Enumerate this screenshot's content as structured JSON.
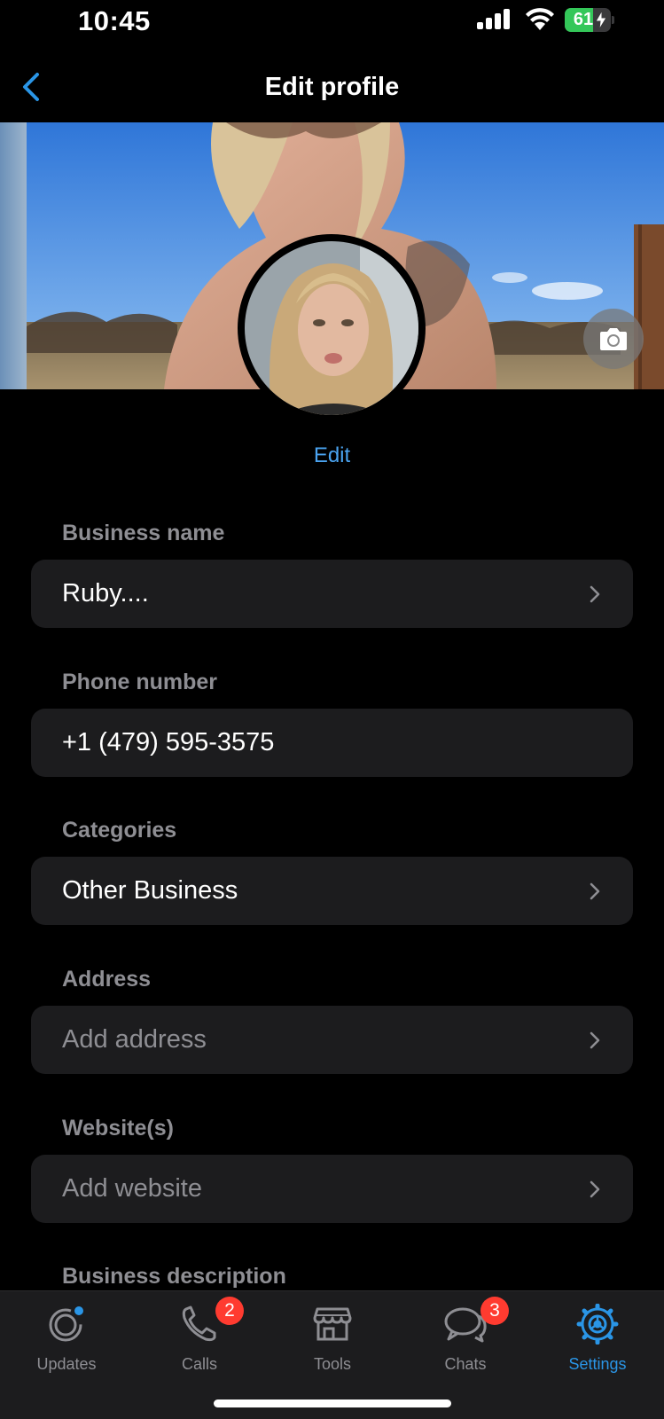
{
  "status_bar": {
    "time": "10:45",
    "battery": "61",
    "battery_level": 0.61
  },
  "nav": {
    "title": "Edit profile"
  },
  "profile": {
    "edit_label": "Edit"
  },
  "form": {
    "business_name": {
      "label": "Business name",
      "value": "Ruby...."
    },
    "phone_number": {
      "label": "Phone number",
      "value": "+1 (479) 595-3575"
    },
    "categories": {
      "label": "Categories",
      "value": "Other Business"
    },
    "address": {
      "label": "Address",
      "placeholder": "Add address"
    },
    "websites": {
      "label": "Website(s)",
      "placeholder": "Add website"
    },
    "business_description": {
      "label": "Business description"
    }
  },
  "tab_bar": {
    "tabs": [
      {
        "label": "Updates",
        "icon": "updates-icon",
        "active": false
      },
      {
        "label": "Calls",
        "icon": "phone-icon",
        "badge": "2",
        "active": false
      },
      {
        "label": "Tools",
        "icon": "storefront-icon",
        "active": false
      },
      {
        "label": "Chats",
        "icon": "chat-bubbles-icon",
        "badge": "3",
        "active": false
      },
      {
        "label": "Settings",
        "icon": "gear-icon",
        "active": true
      }
    ]
  },
  "colors": {
    "accent": "#2a95e6",
    "link": "#4aa3f0",
    "badge": "#ff3b30",
    "field_bg": "#1c1c1e",
    "battery_green": "#34c759"
  }
}
